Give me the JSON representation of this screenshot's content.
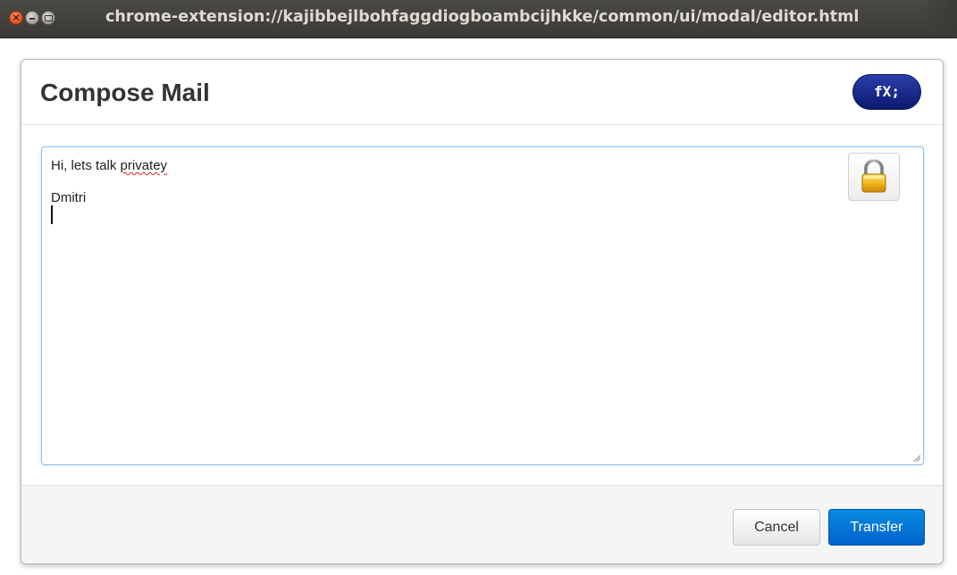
{
  "window": {
    "title": "chrome-extension://kajibbejlbohfaggdiogboambcijhkke/common/ui/modal/editor.html",
    "close_glyph": "×"
  },
  "modal": {
    "title": "Compose Mail",
    "badge": "fX;",
    "editor": {
      "line1_prefix": "Hi, lets talk ",
      "line1_misspelled": "privatey",
      "line2": "",
      "line3": "Dmitri"
    },
    "lock_icon": "lock-icon",
    "buttons": {
      "cancel": "Cancel",
      "transfer": "Transfer"
    }
  },
  "colors": {
    "titlebar": "#3b3a36",
    "primary_button": "#0062cc",
    "badge": "#0a1a70",
    "editor_focus_border": "#8fbfe6"
  }
}
